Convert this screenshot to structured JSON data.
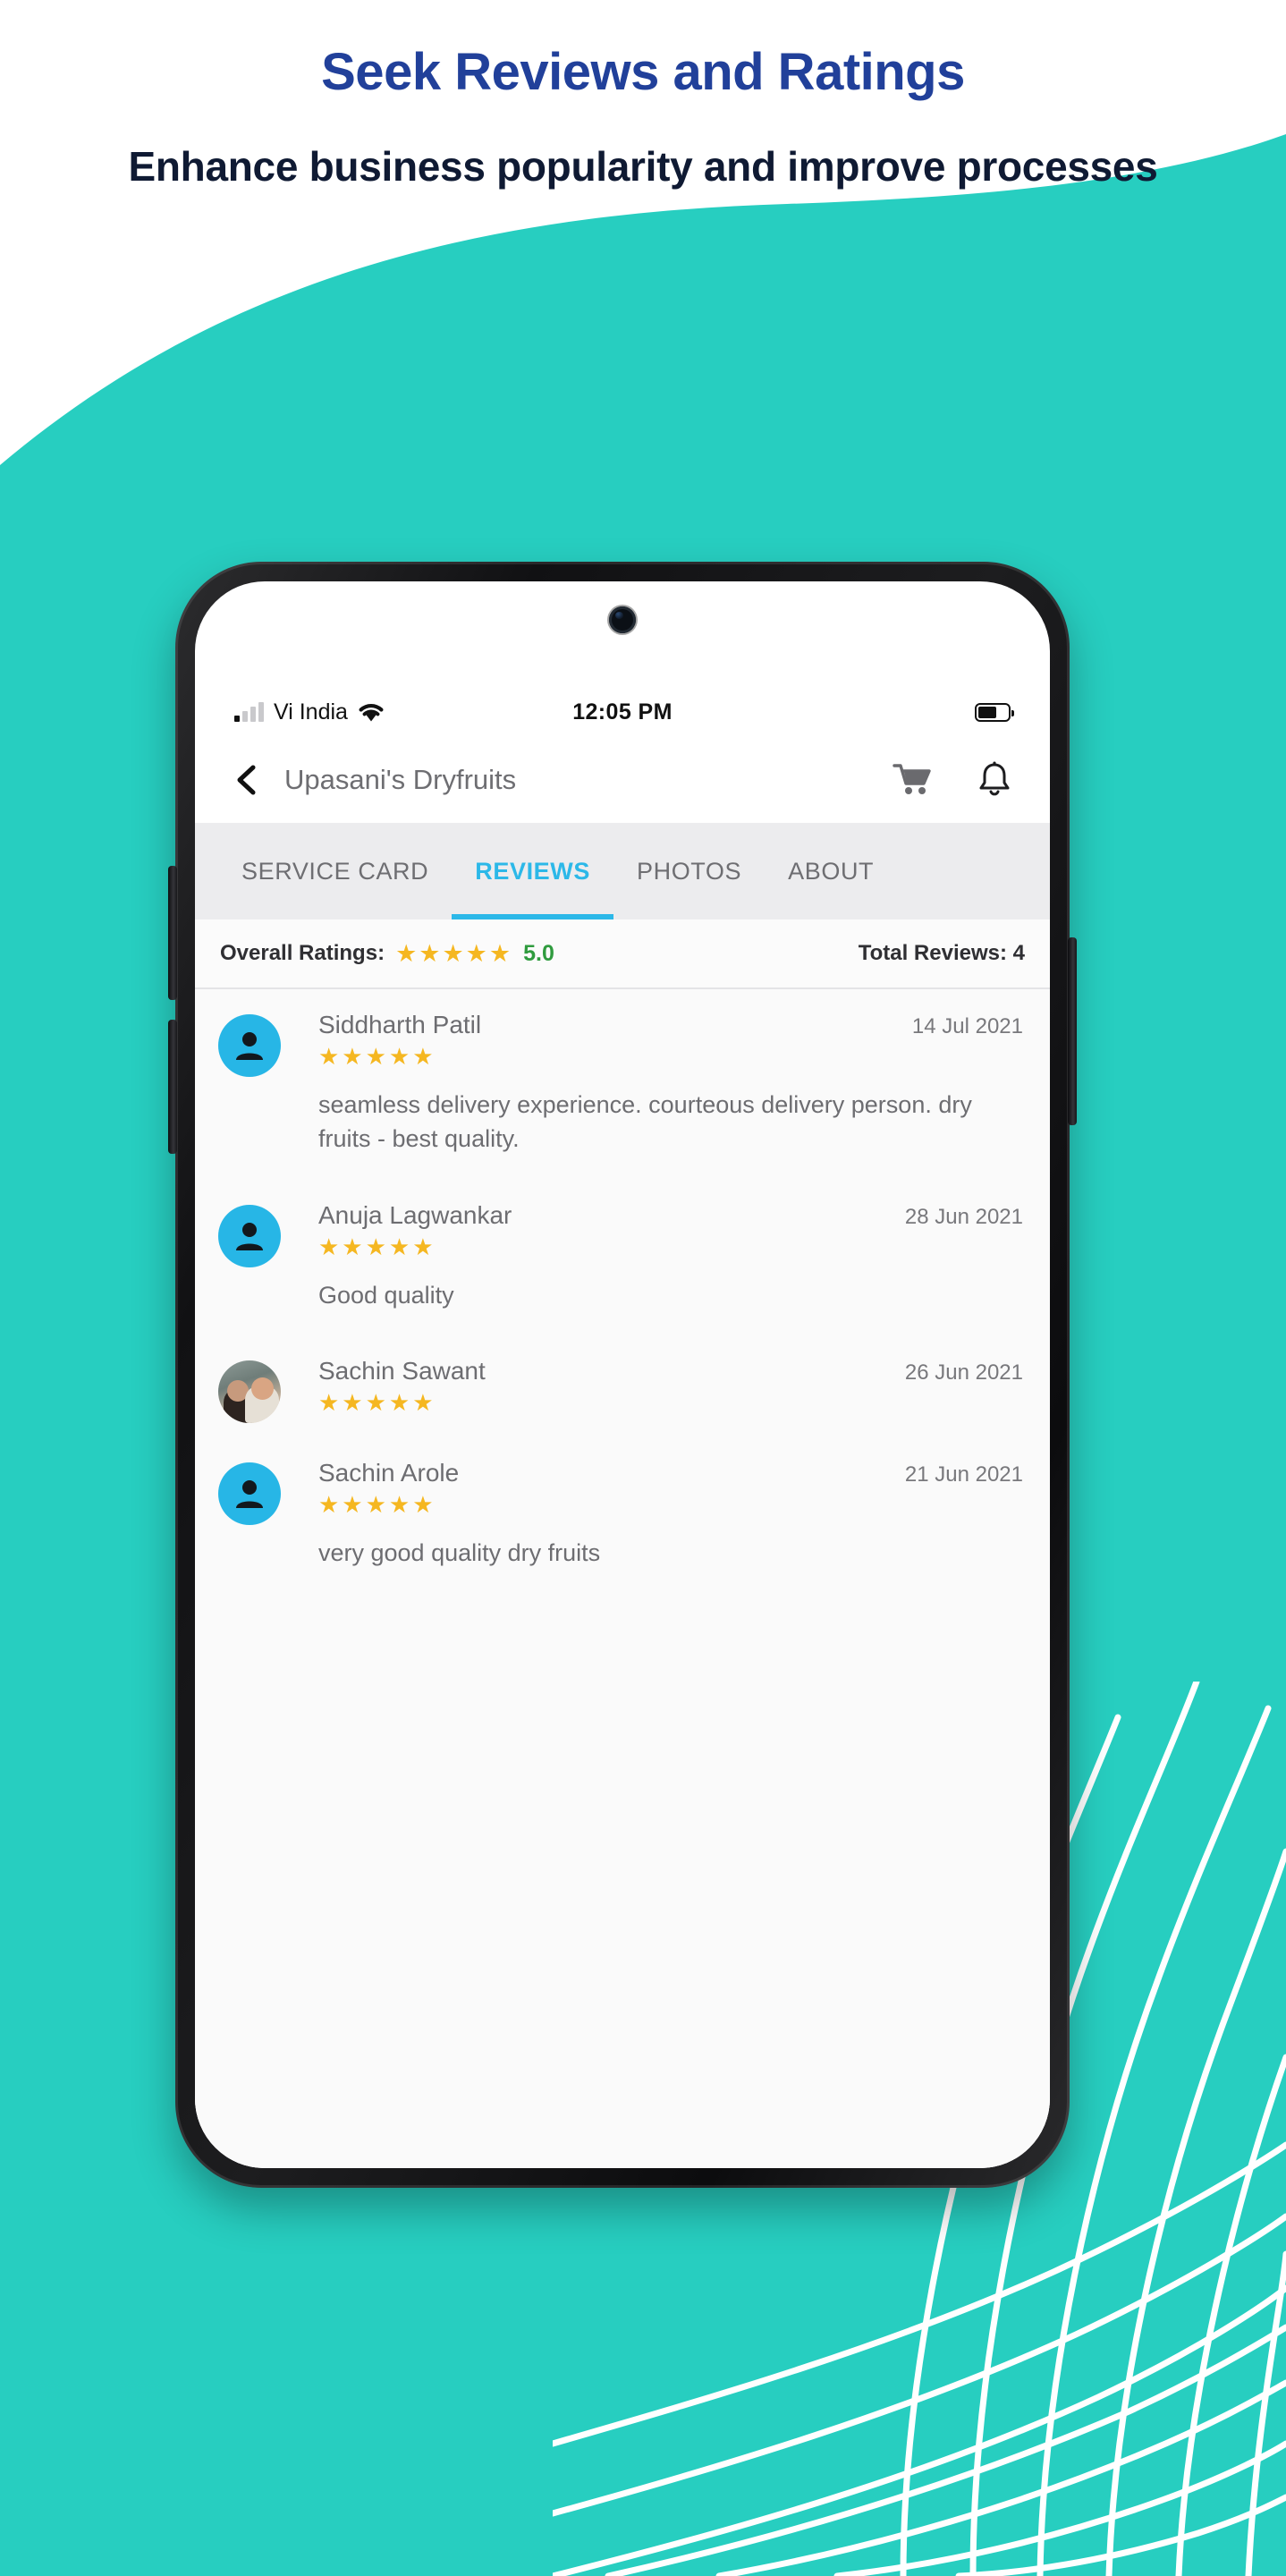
{
  "promo": {
    "headline": "Seek Reviews and Ratings",
    "subheadline": "Enhance business popularity and improve processes",
    "headline_color": "#21409a",
    "subheadline_color": "#0f1a33",
    "background_color": "#27cec0"
  },
  "phone": {
    "status_bar": {
      "carrier": "Vi India",
      "time": "12:05 PM",
      "signal_icon": "signal-bars-icon",
      "wifi_icon": "wifi-icon",
      "battery_icon": "battery-icon"
    },
    "app_bar": {
      "back_icon": "back-chevron-icon",
      "title": "Upasani's Dryfruits",
      "cart_icon": "shopping-cart-icon",
      "bell_icon": "notification-bell-icon"
    },
    "tabs": [
      {
        "label": "SERVICE CARD",
        "active": false
      },
      {
        "label": "REVIEWS",
        "active": true
      },
      {
        "label": "PHOTOS",
        "active": false
      },
      {
        "label": "ABOUT",
        "active": false
      }
    ],
    "tab_active_color": "#2cb8e8",
    "ratings_summary": {
      "label": "Overall Ratings:",
      "stars": "★★★★★",
      "value": "5.0",
      "value_color": "#2f9b3e",
      "total_reviews": "Total Reviews: 4",
      "star_color": "#f5b721"
    },
    "reviews": [
      {
        "name": "Siddharth Patil",
        "date": "14 Jul 2021",
        "stars": "★★★★★",
        "text": "seamless delivery experience. courteous delivery person. dry fruits - best quality.",
        "avatar_type": "placeholder"
      },
      {
        "name": "Anuja Lagwankar",
        "date": "28 Jun 2021",
        "stars": "★★★★★",
        "text": "Good quality",
        "avatar_type": "placeholder"
      },
      {
        "name": "Sachin Sawant",
        "date": "26 Jun 2021",
        "stars": "★★★★★",
        "text": "",
        "avatar_type": "photo"
      },
      {
        "name": "Sachin Arole",
        "date": "21 Jun 2021",
        "stars": "★★★★★",
        "text": "very good quality dry fruits",
        "avatar_type": "placeholder"
      }
    ]
  }
}
